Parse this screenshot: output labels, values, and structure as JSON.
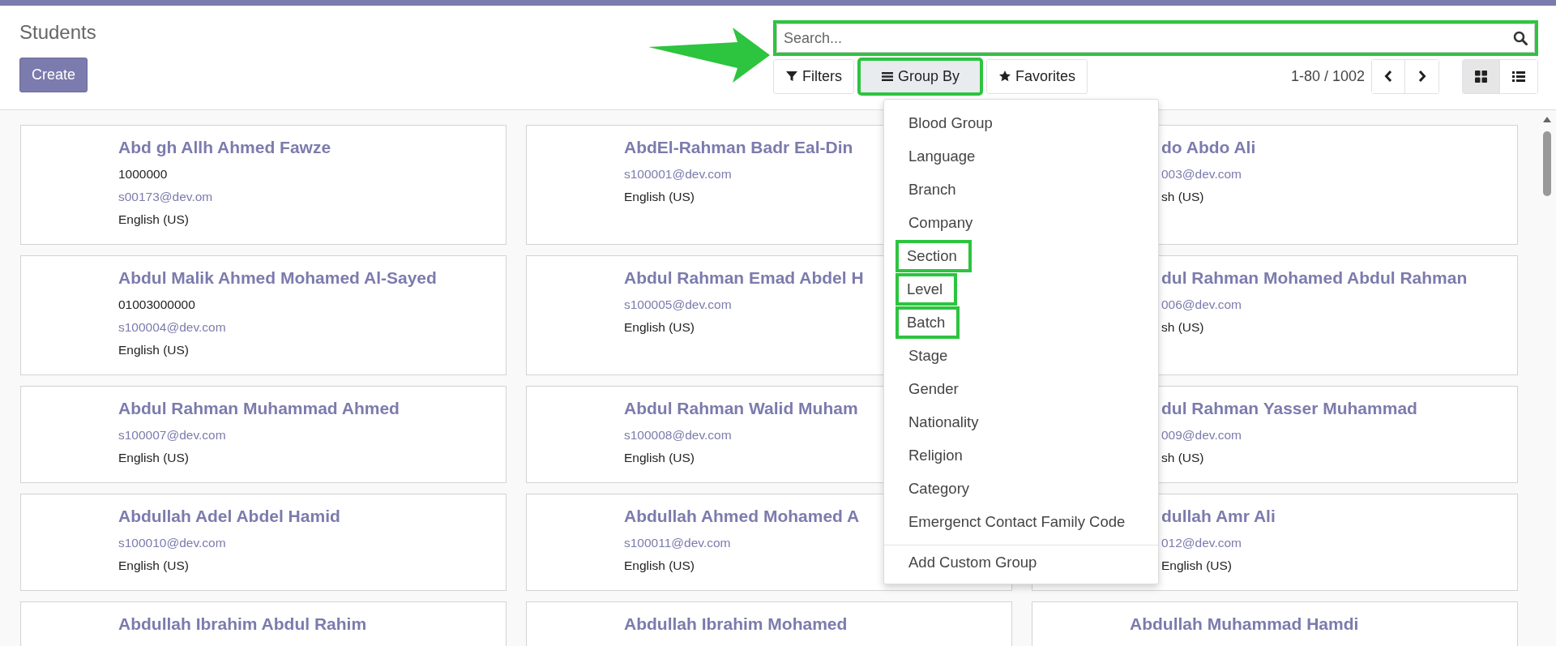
{
  "title": "Students",
  "create_button": "Create",
  "search": {
    "placeholder": "Search...",
    "highlighted": true,
    "pointer_arrow": true
  },
  "search_options": [
    {
      "label": "Filters",
      "kind": "filter",
      "open": false,
      "highlighted": false
    },
    {
      "label": "Group By",
      "kind": "group",
      "open": true,
      "highlighted": true
    },
    {
      "label": "Favorites",
      "kind": "favorite",
      "open": false,
      "highlighted": false
    }
  ],
  "pager": {
    "range": "1-80 / 1002"
  },
  "views": [
    {
      "kind": "kanban",
      "selected": true
    },
    {
      "kind": "list",
      "selected": false
    }
  ],
  "group_by_menu": {
    "items": [
      {
        "label": "Blood Group",
        "highlighted": false
      },
      {
        "label": "Language",
        "highlighted": false
      },
      {
        "label": "Branch",
        "highlighted": false
      },
      {
        "label": "Company",
        "highlighted": false
      },
      {
        "label": "Section",
        "highlighted": true
      },
      {
        "label": "Level",
        "highlighted": true
      },
      {
        "label": "Batch",
        "highlighted": true
      },
      {
        "label": "Stage",
        "highlighted": false
      },
      {
        "label": "Gender",
        "highlighted": false
      },
      {
        "label": "Nationality",
        "highlighted": false
      },
      {
        "label": "Religion",
        "highlighted": false
      },
      {
        "label": "Category",
        "highlighted": false
      },
      {
        "label": "Emergenct Contact Family Code",
        "highlighted": false
      }
    ],
    "custom": "Add Custom Group"
  },
  "cards": [
    {
      "name": "Abd gh Allh Ahmed Fawze",
      "phone": "1000000",
      "email": "s00173@dev.om",
      "language": "English (US)"
    },
    {
      "name": "AbdEl-Rahman Badr Eal-Din",
      "email": "s100001@dev.com",
      "language": "English (US)"
    },
    {
      "name": "do Abdo Ali",
      "email": "003@dev.com",
      "language": "sh (US)"
    },
    {
      "name": "Abdul Malik Ahmed Mohamed Al-Sayed",
      "phone": "01003000000",
      "email": "s100004@dev.com",
      "language": "English (US)"
    },
    {
      "name": "Abdul Rahman Emad Abdel H",
      "email": "s100005@dev.com",
      "language": "English (US)"
    },
    {
      "name": "dul Rahman Mohamed Abdul Rahman",
      "email": "006@dev.com",
      "language": "sh (US)"
    },
    {
      "name": "Abdul Rahman Muhammad Ahmed",
      "email": "s100007@dev.com",
      "language": "English (US)"
    },
    {
      "name": "Abdul Rahman Walid Muham",
      "email": "s100008@dev.com",
      "language": "English (US)"
    },
    {
      "name": "dul Rahman Yasser Muhammad",
      "email": "009@dev.com",
      "language": "sh (US)"
    },
    {
      "name": "Abdullah Adel Abdel Hamid",
      "email": "s100010@dev.com",
      "language": "English (US)"
    },
    {
      "name": "Abdullah Ahmed Mohamed A",
      "email": "s100011@dev.com",
      "language": "English (US)"
    },
    {
      "name": "dullah Amr Ali",
      "email": "012@dev.com",
      "language": "English (US)"
    },
    {
      "name": "Abdullah Ibrahim Abdul Rahim"
    },
    {
      "name": "Abdullah Ibrahim Mohamed"
    },
    {
      "name": "Abdullah Muhammad Hamdi"
    }
  ]
}
